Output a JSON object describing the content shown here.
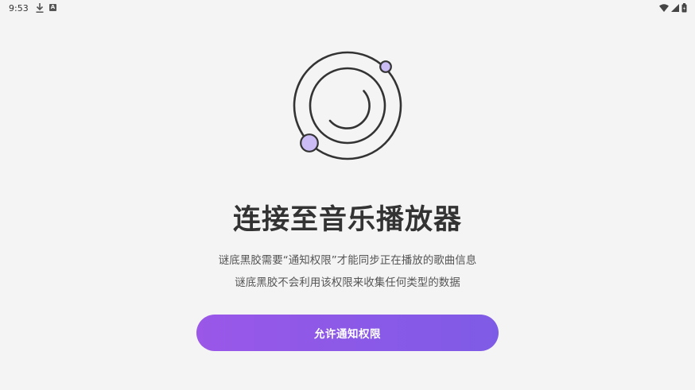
{
  "status_bar": {
    "time": "9:53",
    "icons": [
      "download-icon",
      "app-a-icon",
      "wifi-icon",
      "signal-icon",
      "battery-icon"
    ],
    "a_glyph": "A"
  },
  "hero": {
    "logo_icon": "vinyl-orbit-icon",
    "accent_color": "#cbbcf6"
  },
  "title": "连接至音乐播放器",
  "description": {
    "line1": "谜底黑胶需要“通知权限”才能同步正在播放的歌曲信息",
    "line2": "谜底黑胶不会利用该权限来收集任何类型的数据"
  },
  "allow_button": {
    "label": "允许通知权限",
    "color_start": "#9a57e8",
    "color_end": "#7e5be6"
  }
}
